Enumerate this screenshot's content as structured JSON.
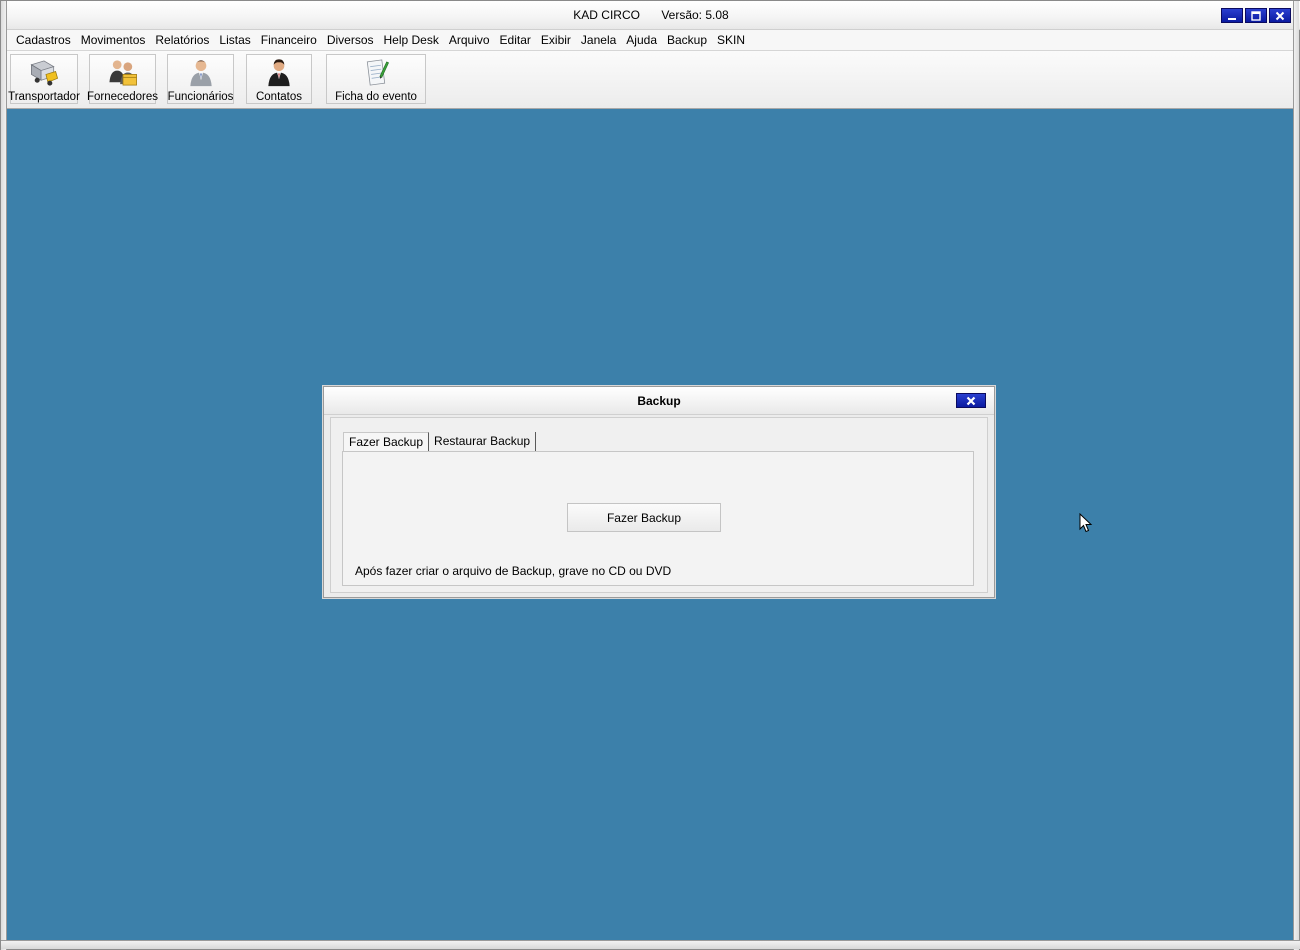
{
  "app": {
    "title": "KAD CIRCO",
    "version": "Versão: 5.08",
    "window_buttons": [
      "minimize-icon",
      "maximize-icon",
      "close-icon"
    ]
  },
  "menubar": {
    "items": [
      "Cadastros",
      "Movimentos",
      "Relatórios",
      "Listas",
      "Financeiro",
      "Diversos",
      "Help Desk",
      "Arquivo",
      "Editar",
      "Exibir",
      "Janela",
      "Ajuda",
      "Backup",
      "SKIN"
    ]
  },
  "toolbar": {
    "buttons": [
      {
        "label": "Transportador",
        "icon": "truck-icon"
      },
      {
        "label": "Fornecedores",
        "icon": "suppliers-icon"
      },
      {
        "label": "Funcionários",
        "icon": "employee-icon"
      },
      {
        "label": "Contatos",
        "icon": "contact-icon"
      },
      {
        "label": "Ficha do evento",
        "icon": "event-form-icon"
      }
    ]
  },
  "dialog": {
    "title": "Backup",
    "close_label": "X",
    "tabs": [
      {
        "label": "Fazer Backup",
        "active": true
      },
      {
        "label": "Restaurar Backup",
        "active": false
      }
    ],
    "action_button": "Fazer Backup",
    "note": "Após fazer criar o arquivo de Backup, grave no CD ou DVD"
  },
  "colors": {
    "desktop": "#3c80aa",
    "window_button": "#1a2bbd"
  }
}
